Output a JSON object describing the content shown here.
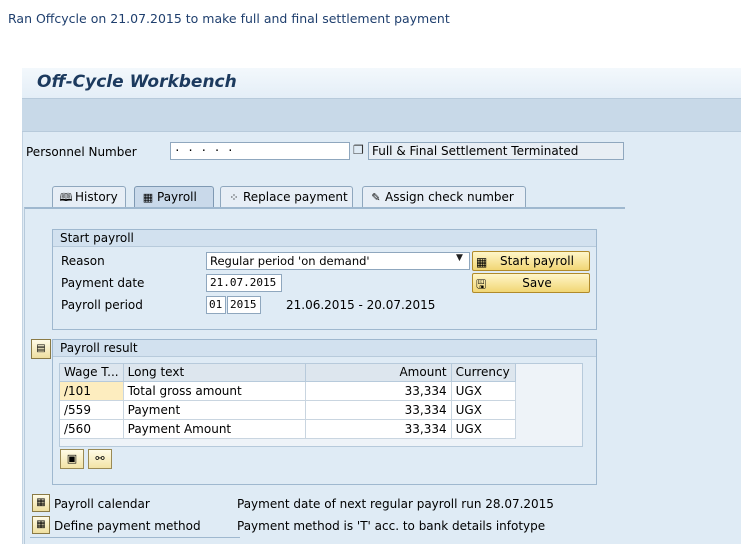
{
  "caption": "Ran Offcycle on 21.07.2015 to make full and final settlement payment",
  "app": {
    "title": "Off-Cycle Workbench"
  },
  "personnel": {
    "label": "Personnel Number",
    "number": "· · · · ·",
    "text": "Full & Final Settlement Terminated"
  },
  "tabs": [
    {
      "label": "History",
      "icon": "history-icon"
    },
    {
      "label": "Payroll",
      "icon": "calculator-icon",
      "active": true
    },
    {
      "label": "Replace payment",
      "icon": "replace-icon"
    },
    {
      "label": "Assign check number",
      "icon": "check-icon"
    }
  ],
  "start_payroll": {
    "title": "Start payroll",
    "reason_label": "Reason",
    "reason_value": "Regular period 'on demand'",
    "payment_date_label": "Payment date",
    "payment_date_value": "21.07.2015",
    "period_label": "Payroll period",
    "period_number": "01",
    "period_year": "2015",
    "period_range": "21.06.2015 - 20.07.2015",
    "start_button": "Start payroll",
    "save_button": "Save"
  },
  "payroll_result": {
    "title": "Payroll result",
    "columns": [
      "Wage T...",
      "Long text",
      "Amount",
      "Currency"
    ],
    "rows": [
      [
        "/101",
        "Total gross amount",
        "33,334",
        "UGX"
      ],
      [
        "/559",
        "Payment",
        "33,334",
        "UGX"
      ],
      [
        "/560",
        "Payment Amount",
        "33,334",
        "UGX"
      ]
    ]
  },
  "footer": {
    "calendar_label": "Payroll calendar",
    "calendar_text": "Payment date of next regular payroll run 28.07.2015",
    "method_label": "Define payment method",
    "method_text": "Payment method is 'T' acc. to bank details infotype"
  },
  "colors": {
    "title": "#1c3a5e",
    "caption": "#1f3f6e",
    "button": "#f1d675",
    "selected_cell": "#fdedbf"
  }
}
